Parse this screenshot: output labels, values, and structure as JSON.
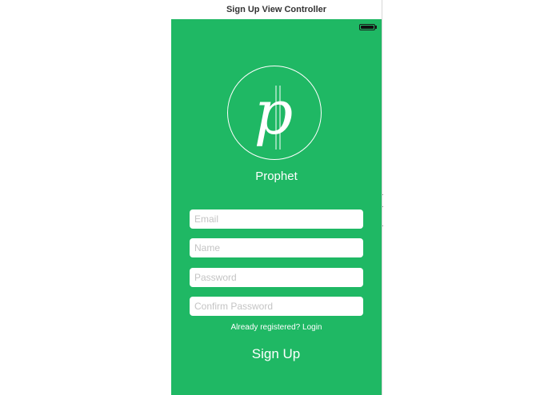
{
  "header": {
    "title": "Sign Up View Controller"
  },
  "app": {
    "logo_letter": "p",
    "name": "Prophet"
  },
  "form": {
    "email_placeholder": "Email",
    "name_placeholder": "Name",
    "password_placeholder": "Password",
    "confirm_password_placeholder": "Confirm Password",
    "email_value": "",
    "name_value": "",
    "password_value": "",
    "confirm_password_value": ""
  },
  "links": {
    "login": "Already registered? Login"
  },
  "actions": {
    "sign_up": "Sign Up"
  },
  "colors": {
    "brand_green": "#1fb864",
    "text_on_brand": "#ffffff"
  },
  "icons": {
    "battery": "battery-icon",
    "logo": "prophet-logo-icon"
  }
}
